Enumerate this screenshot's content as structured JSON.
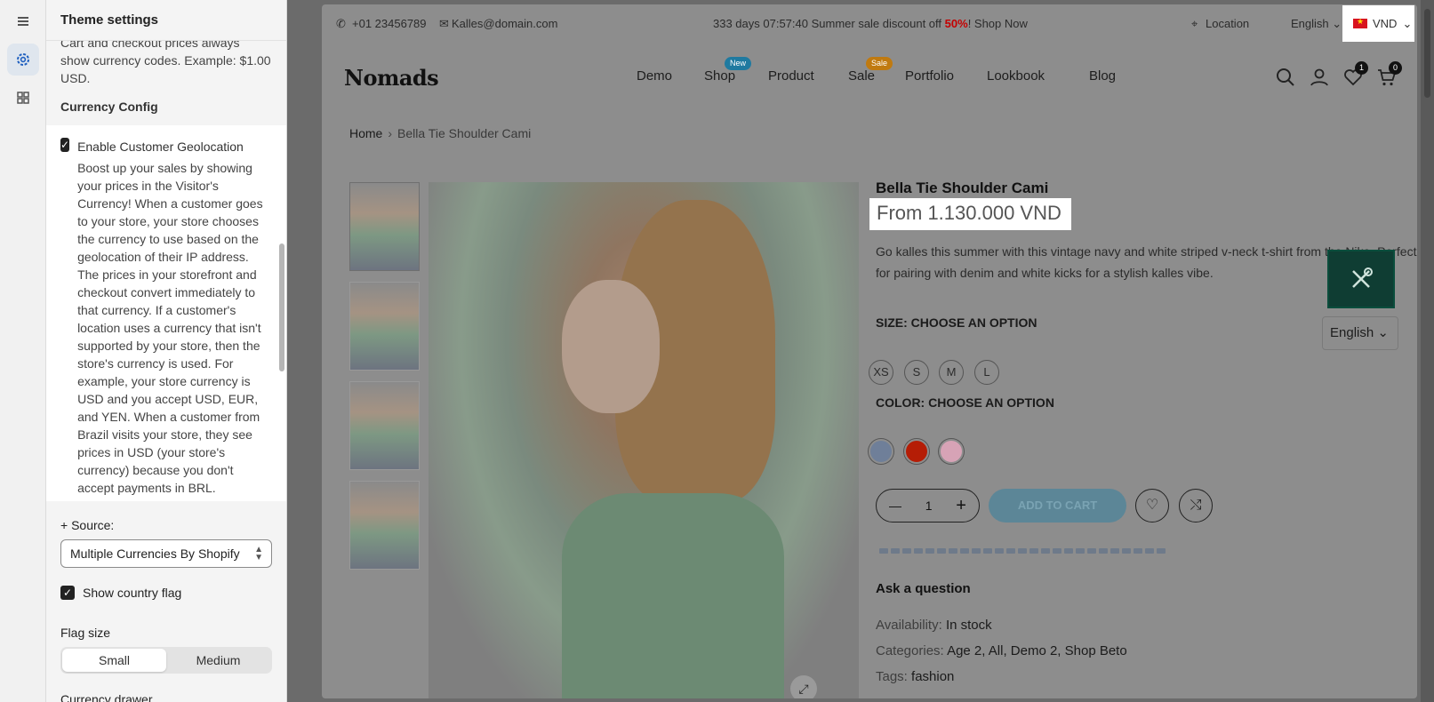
{
  "panel": {
    "title": "Theme settings",
    "intro_text": "Cart and checkout prices always show currency codes. Example: $1.00 USD.",
    "currency_config_title": "Currency Config",
    "geolocation": {
      "checked": true,
      "label": "Enable Customer Geolocation",
      "description": "Boost up your sales by showing your prices in the Visitor's Currency! When a customer goes to your store, your store chooses the currency to use based on the geolocation of their IP address. The prices in your storefront and checkout convert immediately to that currency. If a customer's location uses a currency that isn't supported by your store, then the store's currency is used. For example, your store currency is USD and you accept USD, EUR, and YEN. When a customer from Brazil visits your store, they see prices in USD (your store's currency) because you don't accept payments in BRL."
    },
    "source_label": "+ Source:",
    "source_value": "Multiple Currencies By Shopify",
    "show_flag": {
      "checked": true,
      "label": "Show country flag"
    },
    "flag_size_label": "Flag size",
    "flag_size_options": [
      "Small",
      "Medium"
    ],
    "flag_size_selected": "Small",
    "currency_drawer_label": "Currency drawer"
  },
  "topbar": {
    "phone": "+01 23456789",
    "email": "Kalles@domain.com",
    "promo_prefix": "333 days 07:57:40 Summer sale discount off ",
    "promo_percent": "50%",
    "promo_suffix": "! Shop Now",
    "location": "Location",
    "language": "English",
    "currency": "VND"
  },
  "header": {
    "logo": "Nomads",
    "nav": [
      "Demo",
      "Shop",
      "Product",
      "Sale",
      "Portfolio",
      "Lookbook",
      "Blog"
    ],
    "badge_new": "New",
    "badge_sale": "Sale",
    "wishlist_count": "1",
    "cart_count": "0"
  },
  "breadcrumb": {
    "home": "Home",
    "current": "Bella Tie Shoulder Cami"
  },
  "product": {
    "title": "Bella Tie Shoulder Cami",
    "price": "From 1.130.000 VND",
    "description": "Go kalles this summer with this vintage navy and white striped v-neck t-shirt from the Nike. Perfect for pairing with denim and white kicks for a stylish kalles vibe.",
    "size_label": "SIZE: CHOOSE AN OPTION",
    "sizes": [
      "XS",
      "S",
      "M",
      "L"
    ],
    "color_label": "COLOR: CHOOSE AN OPTION",
    "colors": [
      "#6f7f99",
      "#b51d06",
      "#d7a3b6"
    ],
    "quantity": "1",
    "add_to_cart": "ADD TO CART",
    "ask_question": "Ask a question",
    "availability_label": "Availability:",
    "availability_value": "In stock",
    "categories_label": "Categories:",
    "categories_value": "Age 2, All, Demo 2, Shop Beto",
    "tags_label": "Tags:",
    "tags_value": "fashion"
  },
  "floating": {
    "language": "English"
  },
  "colors": {
    "accent_dark_green": "#0f3d33",
    "sale_red": "#c40000",
    "cart_btn": "#5c8697"
  }
}
